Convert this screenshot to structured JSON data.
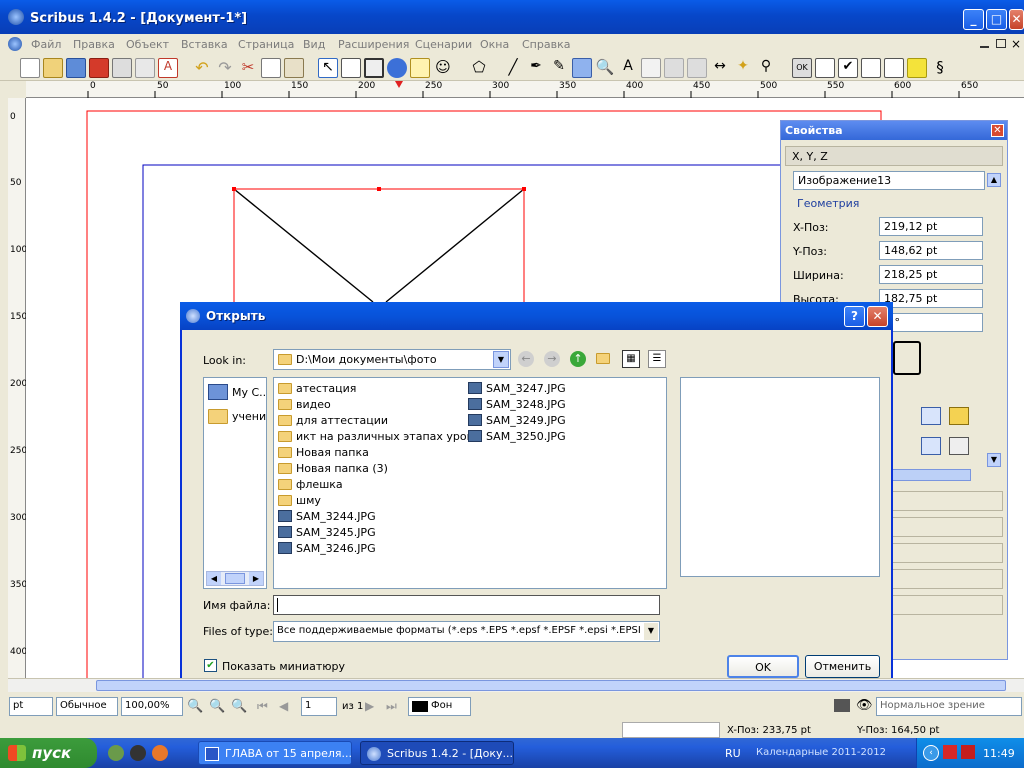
{
  "window": {
    "title": "Scribus 1.4.2 - [Документ-1*]",
    "min": "_",
    "max": "□",
    "close": "✕"
  },
  "menu": [
    "Файл",
    "Правка",
    "Объект",
    "Вставка",
    "Страница",
    "Вид",
    "Расширения",
    "Сценарии",
    "Окна",
    "Справка"
  ],
  "ruler": {
    "h": [
      "0",
      "50",
      "100",
      "150",
      "200",
      "250",
      "300",
      "350",
      "400",
      "450",
      "500",
      "550",
      "600",
      "650"
    ],
    "v": [
      "0",
      "50",
      "100",
      "150",
      "200",
      "250",
      "300",
      "350",
      "400"
    ]
  },
  "properties": {
    "title": "Свойства",
    "section_xyz": "X, Y, Z",
    "object_name": "Изображение13",
    "geometry": "Геометрия",
    "x_label": "X-Поз:",
    "x_value": "219,12 pt",
    "y_label": "Y-Поз:",
    "y_value": "148,62 pt",
    "w_label": "Ширина:",
    "w_value": "218,25 pt",
    "h_label": "Высота:",
    "h_value": "182,75 pt",
    "rot_value": "0 °"
  },
  "dialog": {
    "title": "Открыть",
    "help": "?",
    "close": "✕",
    "look_in_label": "Look in:",
    "look_in_path": "D:\\Мои документы\\фото",
    "places": [
      "My C...",
      "учени"
    ],
    "folders": [
      "атестация",
      "видео",
      "для аттестации",
      "икт на различных этапах урока",
      "Новая папка",
      "Новая папка (3)",
      "флешка",
      "шму"
    ],
    "files_col1": [
      "SAM_3244.JPG",
      "SAM_3245.JPG",
      "SAM_3246.JPG"
    ],
    "files_col2": [
      "SAM_3247.JPG",
      "SAM_3248.JPG",
      "SAM_3249.JPG",
      "SAM_3250.JPG"
    ],
    "filename_label": "Имя файла:",
    "filename_value": "",
    "filetype_label": "Files of type:",
    "filetype_value": "Все поддерживаемые форматы (*.eps *.EPS *.epsf *.EPSF *.epsi *.EPSI *",
    "preview_label": "Показать миниатюру",
    "ok": "OK",
    "cancel": "Отменить"
  },
  "status": {
    "unit": "pt",
    "mode": "Обычное",
    "zoom": "100,00%",
    "page": "1",
    "of": "из 1",
    "layer": "Фон",
    "view": "Нормальное зрение",
    "xpos": "X-Поз: 233,75 pt",
    "ypos": "Y-Поз: 164,50 pt"
  },
  "taskbar": {
    "start": "пуск",
    "task1": "ГЛАВА от 15 апреля...",
    "task2": "Scribus 1.4.2 - [Доку...",
    "lang": "RU",
    "calendar": "Календарные 2011-2012",
    "time": "11:49"
  },
  "colors": {
    "title_blue": "#0a5ce8",
    "page_border": "#ff0000",
    "margin": "#0000c0",
    "taskbar": "#245edb",
    "start_green": "#3c9c3c"
  }
}
